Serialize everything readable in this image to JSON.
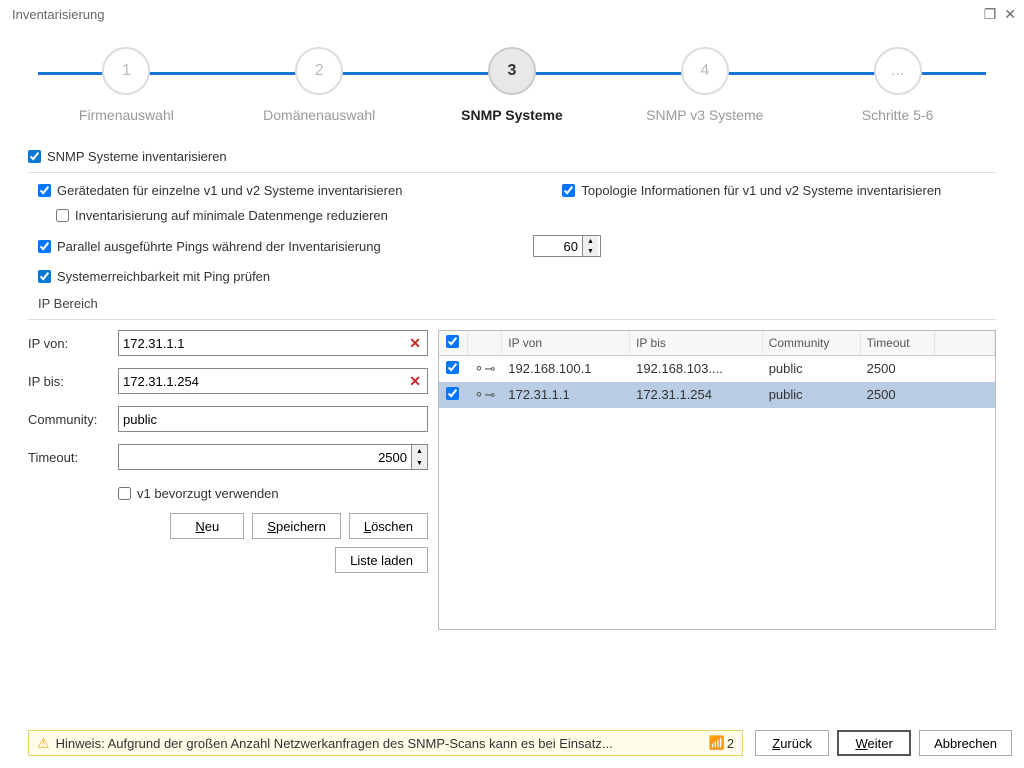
{
  "title": "Inventarisierung",
  "steps": [
    {
      "num": "1",
      "label": "Firmenauswahl",
      "active": false
    },
    {
      "num": "2",
      "label": "Domänenauswahl",
      "active": false
    },
    {
      "num": "3",
      "label": "SNMP Systeme",
      "active": true
    },
    {
      "num": "4",
      "label": "SNMP v3 Systeme",
      "active": false
    },
    {
      "num": "...",
      "label": "Schritte 5-6",
      "active": false
    }
  ],
  "chk": {
    "inventory": "SNMP Systeme inventarisieren",
    "devicedata": "Gerätedaten für einzelne v1 und v2 Systeme inventarisieren",
    "topology": "Topologie Informationen für v1 und v2 Systeme inventarisieren",
    "minimal": "Inventarisierung auf minimale Datenmenge reduzieren",
    "parallel": "Parallel ausgeführte Pings während der Inventarisierung",
    "pingcheck": "Systemerreichbarkeit mit Ping prüfen",
    "v1pref": "v1 bevorzugt verwenden"
  },
  "parallel_value": "60",
  "ip_section": "IP Bereich",
  "labels": {
    "ip_from": "IP von:",
    "ip_to": "IP bis:",
    "community": "Community:",
    "timeout": "Timeout:"
  },
  "values": {
    "ip_from": "172.31.1.1",
    "ip_to": "172.31.1.254",
    "community": "public",
    "timeout": "2500"
  },
  "buttons": {
    "new": "Neu",
    "save": "Speichern",
    "delete": "Löschen",
    "loadlist": "Liste laden",
    "back": "Zurück",
    "next": "Weiter",
    "cancel": "Abbrechen"
  },
  "table": {
    "headers": {
      "ip_from": "IP von",
      "ip_to": "IP bis",
      "community": "Community",
      "timeout": "Timeout"
    },
    "rows": [
      {
        "checked": true,
        "ip_from": "192.168.100.1",
        "ip_to": "192.168.103....",
        "community": "public",
        "timeout": "2500",
        "selected": false
      },
      {
        "checked": true,
        "ip_from": "172.31.1.1",
        "ip_to": "172.31.1.254",
        "community": "public",
        "timeout": "2500",
        "selected": true
      }
    ]
  },
  "hint": {
    "text": "Hinweis: Aufgrund der großen Anzahl Netzwerkanfragen des SNMP-Scans kann es bei Einsatz...",
    "count": "2"
  }
}
